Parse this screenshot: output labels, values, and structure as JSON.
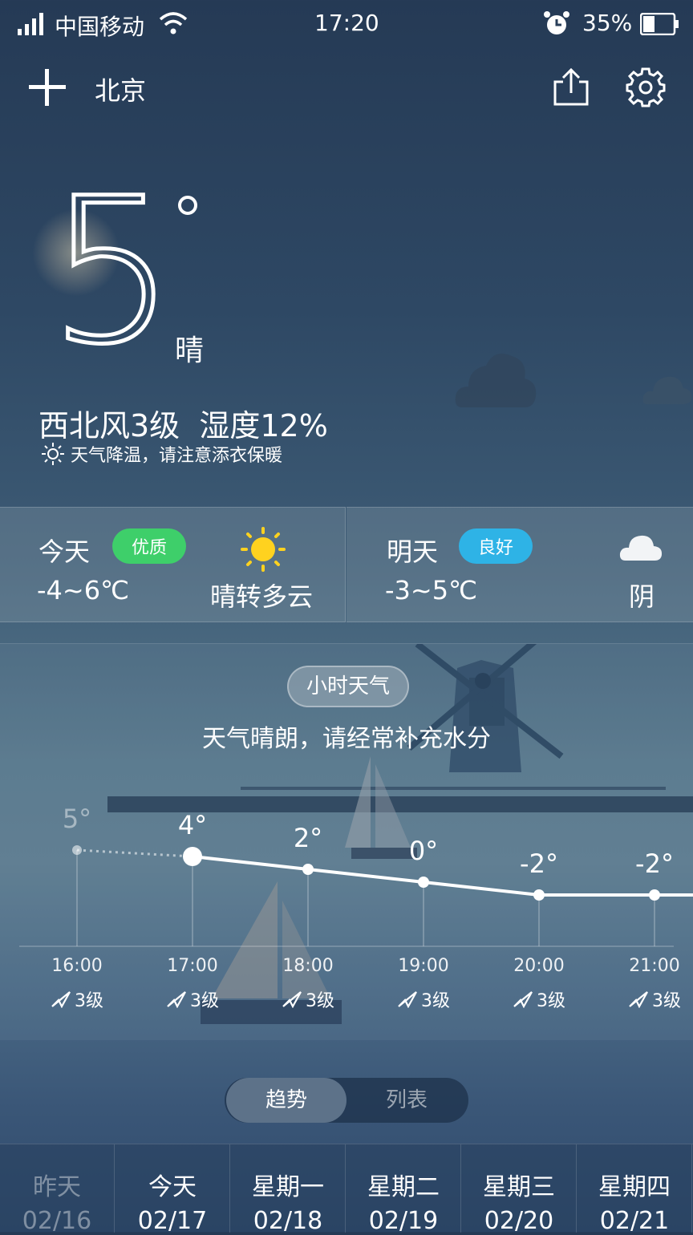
{
  "status_bar": {
    "carrier": "中国移动",
    "time": "17:20",
    "battery": "35%"
  },
  "header": {
    "city": "北京"
  },
  "current": {
    "temperature": "5",
    "condition": "晴",
    "wind_humidity": "西北风3级  湿度12%",
    "tip": "天气降温，请注意添衣保暖"
  },
  "today": {
    "label": "今天",
    "aqi": "优质",
    "aqi_color": "#3ecf6a",
    "temp_range": "-4~6℃",
    "condition": "晴转多云"
  },
  "tomorrow": {
    "label": "明天",
    "aqi": "良好",
    "aqi_color": "#2eb3e6",
    "temp_range": "-3~5℃",
    "condition": "阴"
  },
  "hourly": {
    "pill": "小时天气",
    "tip": "天气晴朗，请经常补充水分",
    "hours": [
      {
        "time": "16:00",
        "temp": "5°",
        "temp_value": 5,
        "wind": "3级"
      },
      {
        "time": "17:00",
        "temp": "4°",
        "temp_value": 4,
        "wind": "3级"
      },
      {
        "time": "18:00",
        "temp": "2°",
        "temp_value": 2,
        "wind": "3级"
      },
      {
        "time": "19:00",
        "temp": "0°",
        "temp_value": 0,
        "wind": "3级"
      },
      {
        "time": "20:00",
        "temp": "-2°",
        "temp_value": -2,
        "wind": "3级"
      },
      {
        "time": "21:00",
        "temp": "-2°",
        "temp_value": -2,
        "wind": "3级"
      }
    ]
  },
  "view_toggle": {
    "trend": "趋势",
    "list": "列表"
  },
  "days": [
    {
      "name": "昨天",
      "date": "02/16"
    },
    {
      "name": "今天",
      "date": "02/17"
    },
    {
      "name": "星期一",
      "date": "02/18"
    },
    {
      "name": "星期二",
      "date": "02/19"
    },
    {
      "name": "星期三",
      "date": "02/20"
    },
    {
      "name": "星期四",
      "date": "02/21"
    }
  ]
}
